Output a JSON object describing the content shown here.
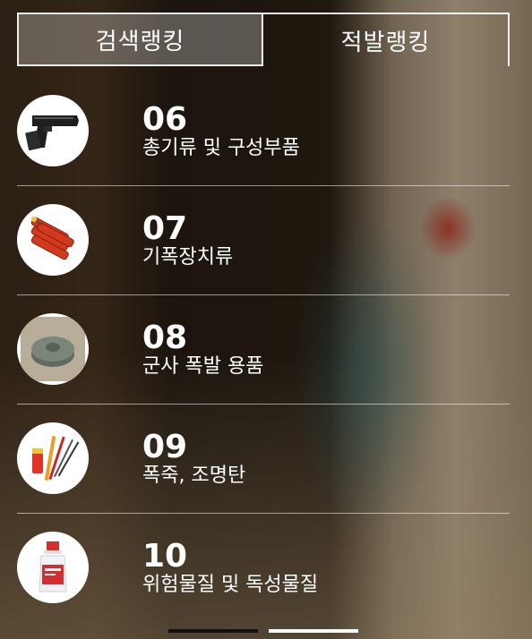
{
  "tabs": [
    {
      "label": "검색랭킹"
    },
    {
      "label": "적발랭킹"
    }
  ],
  "items": [
    {
      "number": "06",
      "label": "총기류 및 구성부품",
      "icon": "handgun-icon"
    },
    {
      "number": "07",
      "label": "기폭장치류",
      "icon": "dynamite-icon"
    },
    {
      "number": "08",
      "label": "군사 폭발 용품",
      "icon": "landmine-icon"
    },
    {
      "number": "09",
      "label": "폭죽, 조명탄",
      "icon": "firecracker-icon"
    },
    {
      "number": "10",
      "label": "위험물질 및 독성물질",
      "icon": "chemical-bottle-icon"
    }
  ],
  "pager": {
    "active": 2,
    "total": 2
  },
  "colors": {
    "pager_inactive": "#111111",
    "pager_active": "#ffffff"
  }
}
